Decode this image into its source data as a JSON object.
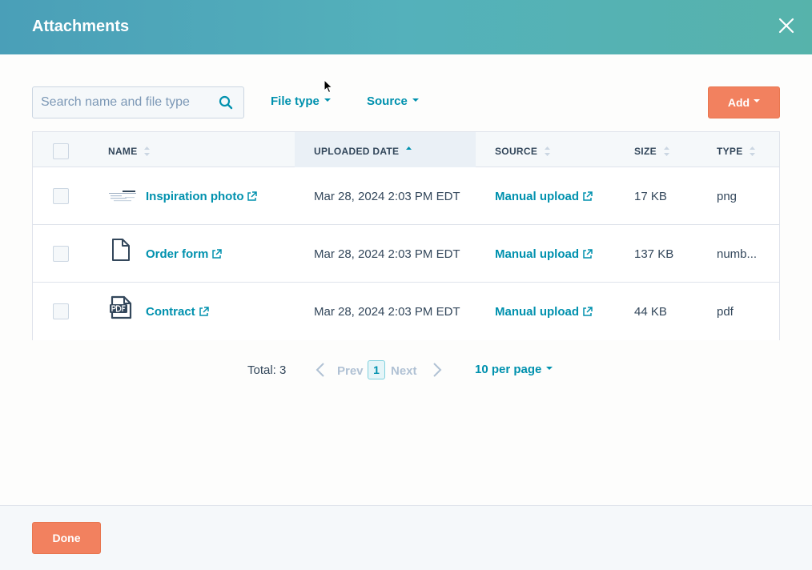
{
  "dialog": {
    "title": "Attachments",
    "close_icon": "close-icon"
  },
  "toolbar": {
    "search_placeholder": "Search name and file type",
    "search_icon": "search-icon",
    "file_type_label": "File type",
    "source_label": "Source",
    "add_label": "Add"
  },
  "table": {
    "columns": {
      "name": "NAME",
      "uploaded_date": "UPLOADED DATE",
      "source": "SOURCE",
      "size": "SIZE",
      "type": "TYPE"
    },
    "sorted_column": "uploaded_date",
    "rows": [
      {
        "icon": "image-thumbnail-icon",
        "name": "Inspiration photo",
        "uploaded": "Mar 28, 2024 2:03 PM EDT",
        "source": "Manual upload",
        "size": "17 KB",
        "type": "png"
      },
      {
        "icon": "document-icon",
        "name": "Order form",
        "uploaded": "Mar 28, 2024 2:03 PM EDT",
        "source": "Manual upload",
        "size": "137 KB",
        "type": "numb..."
      },
      {
        "icon": "pdf-icon",
        "name": "Contract",
        "uploaded": "Mar 28, 2024 2:03 PM EDT",
        "source": "Manual upload",
        "size": "44 KB",
        "type": "pdf"
      }
    ]
  },
  "pagination": {
    "total": "Total: 3",
    "prev": "Prev",
    "page": "1",
    "next": "Next",
    "per_page": "10 per page"
  },
  "footer": {
    "done_label": "Done"
  },
  "colors": {
    "accent": "#0091ae",
    "primary_button": "#f2815f",
    "header_gradient_start": "#4a9fb8",
    "header_gradient_end": "#56b3ab"
  }
}
